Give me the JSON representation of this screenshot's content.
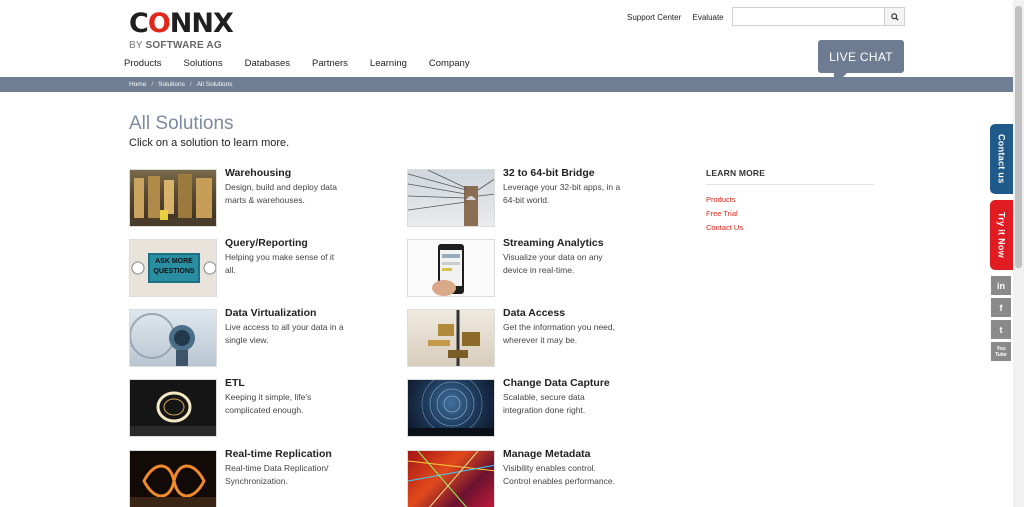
{
  "brand": {
    "logo_text_pre": "C",
    "logo_text_o": "O",
    "logo_text_post": "NNX",
    "sub_prefix": "BY",
    "sub_main": "SOFTWARE AG"
  },
  "top_links": [
    "Support Center",
    "Evaluate"
  ],
  "search": {
    "placeholder": ""
  },
  "nav": [
    "Products",
    "Solutions",
    "Databases",
    "Partners",
    "Learning",
    "Company"
  ],
  "live_chat": "LIVE CHAT",
  "breadcrumb": [
    "Home",
    "Solutions",
    "All Solutions"
  ],
  "page": {
    "title": "All Solutions",
    "subtitle": "Click on a solution to learn more."
  },
  "solutions": [
    {
      "name": "Warehousing",
      "desc": "Design, build and deploy data marts & warehouses."
    },
    {
      "name": "32 to 64-bit Bridge",
      "desc": "Leverage your 32-bit apps, in a 64-bit world."
    },
    {
      "name": "Query/Reporting",
      "desc": "Helping you make sense of it all."
    },
    {
      "name": "Streaming Analytics",
      "desc": "Visualize your data on any device in real-time."
    },
    {
      "name": "Data Virtualization",
      "desc": "Live access to all your data in a single view."
    },
    {
      "name": "Data Access",
      "desc": "Get the information you need, wherever it may be."
    },
    {
      "name": "ETL",
      "desc": "Keeping it simple, life's complicated enough."
    },
    {
      "name": "Change Data Capture",
      "desc": "Scalable, secure data integration done right."
    },
    {
      "name": "Real-time Replication",
      "desc": "Real-time Data Replication/ Synchronization."
    },
    {
      "name": "Manage Metadata",
      "desc": "Visibility enables control. Control enables performance."
    }
  ],
  "thumb_text": {
    "ask": "ASK MORE QUESTIONS"
  },
  "learn_more": {
    "heading": "LEARN MORE",
    "links": [
      "Products",
      "Free Trial",
      "Contact Us"
    ]
  },
  "side_tabs": {
    "contact": "Contact us",
    "try": "Try it Now"
  },
  "social": [
    "in",
    "f",
    "t",
    "You Tube"
  ],
  "colors": {
    "accent_red": "#e1261c",
    "nav_bar": "#6f7e92",
    "title": "#7c8aa0",
    "contact_tab": "#1f5a8a",
    "try_tab": "#e11b22"
  }
}
